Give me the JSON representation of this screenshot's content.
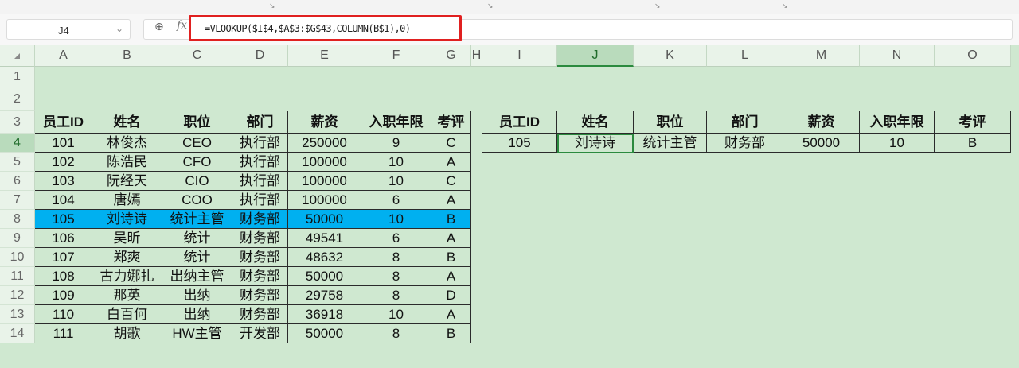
{
  "name_box": "J4",
  "formula": "=VLOOKUP($I$4,$A$3:$G$43,COLUMN(B$1),0)",
  "columns": [
    "A",
    "B",
    "C",
    "D",
    "E",
    "F",
    "G",
    "H",
    "I",
    "J",
    "K",
    "L",
    "M",
    "N",
    "O"
  ],
  "rows": [
    "1",
    "2",
    "3",
    "4",
    "5",
    "6",
    "7",
    "8",
    "9",
    "10",
    "11",
    "12",
    "13",
    "14"
  ],
  "table_headers": [
    "员工ID",
    "姓名",
    "职位",
    "部门",
    "薪资",
    "入职年限",
    "考评"
  ],
  "table_rows": [
    [
      "101",
      "林俊杰",
      "CEO",
      "执行部",
      "250000",
      "9",
      "C"
    ],
    [
      "102",
      "陈浩民",
      "CFO",
      "执行部",
      "100000",
      "10",
      "A"
    ],
    [
      "103",
      "阮经天",
      "CIO",
      "执行部",
      "100000",
      "10",
      "C"
    ],
    [
      "104",
      "唐嫣",
      "COO",
      "执行部",
      "100000",
      "6",
      "A"
    ],
    [
      "105",
      "刘诗诗",
      "统计主管",
      "财务部",
      "50000",
      "10",
      "B"
    ],
    [
      "106",
      "吴昕",
      "统计",
      "财务部",
      "49541",
      "6",
      "A"
    ],
    [
      "107",
      "郑爽",
      "统计",
      "财务部",
      "48632",
      "8",
      "B"
    ],
    [
      "108",
      "古力娜扎",
      "出纳主管",
      "财务部",
      "50000",
      "8",
      "A"
    ],
    [
      "109",
      "那英",
      "出纳",
      "财务部",
      "29758",
      "8",
      "D"
    ],
    [
      "110",
      "白百何",
      "出纳",
      "财务部",
      "36918",
      "10",
      "A"
    ],
    [
      "111",
      "胡歌",
      "HW主管",
      "开发部",
      "50000",
      "8",
      "B"
    ]
  ],
  "lookup_headers": [
    "员工ID",
    "姓名",
    "职位",
    "部门",
    "薪资",
    "入职年限",
    "考评"
  ],
  "lookup_values": [
    "105",
    "刘诗诗",
    "统计主管",
    "财务部",
    "50000",
    "10",
    "B"
  ],
  "highlight_color": "#00b0f0",
  "selected_cell": "J4"
}
